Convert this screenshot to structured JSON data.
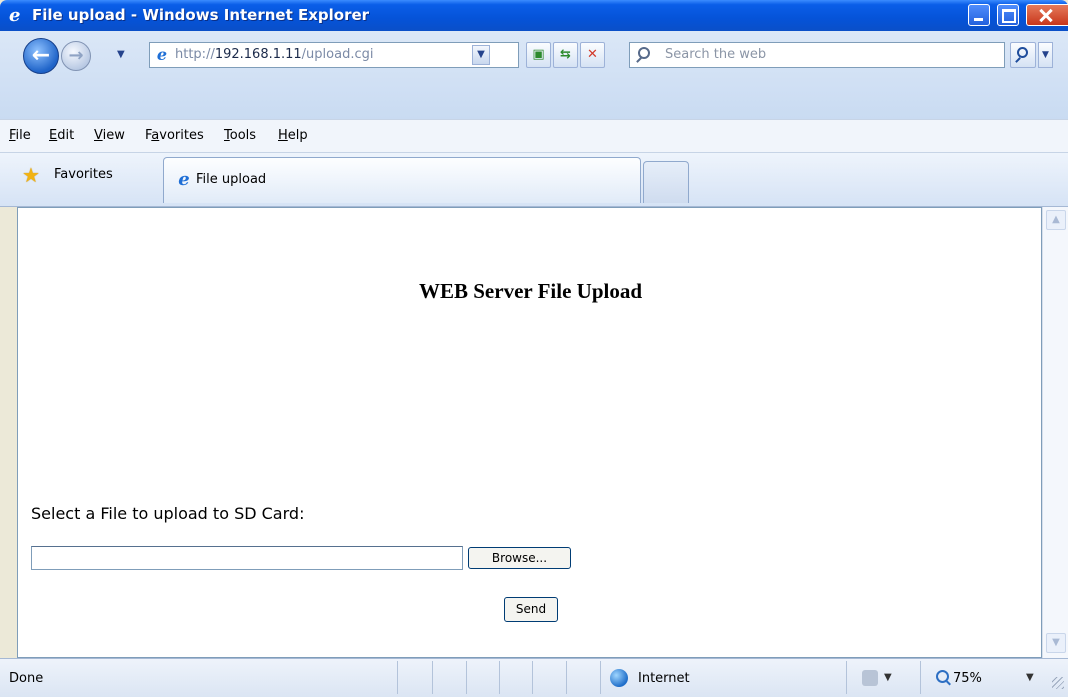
{
  "window": {
    "title": "File upload - Windows Internet Explorer"
  },
  "navigation": {
    "address": {
      "scheme": "http://",
      "host": "192.168.1.11",
      "path": "/upload.cgi"
    },
    "search": {
      "placeholder": "Search the web"
    }
  },
  "menubar": {
    "items": [
      {
        "accel": "F",
        "rest": "ile"
      },
      {
        "accel": "E",
        "rest": "dit"
      },
      {
        "accel": "V",
        "rest": "iew"
      },
      {
        "pre": "F",
        "accel": "a",
        "rest": "vorites"
      },
      {
        "accel": "T",
        "rest": "ools"
      },
      {
        "accel": "H",
        "rest": "elp"
      }
    ]
  },
  "favorites_bar": {
    "favorites_label": "Favorites",
    "tab_label": "File upload"
  },
  "page": {
    "heading": "WEB Server File Upload",
    "select_label": "Select a File to upload to SD Card:",
    "file_value": "",
    "browse_label": "Browse...",
    "send_label": "Send"
  },
  "statusbar": {
    "status": "Done",
    "zone": "Internet",
    "zoom": "75%"
  },
  "icons": {
    "ie_logo": "ie-logo-icon",
    "back": "back-arrow-icon",
    "forward": "forward-arrow-icon",
    "search": "search-icon",
    "favorites": "star-icon",
    "zone": "globe-icon",
    "zoom": "zoom-icon"
  },
  "colors": {
    "titlebar": "#0553d8",
    "close_button": "#c8361b",
    "chrome": "#d6e3f5"
  }
}
